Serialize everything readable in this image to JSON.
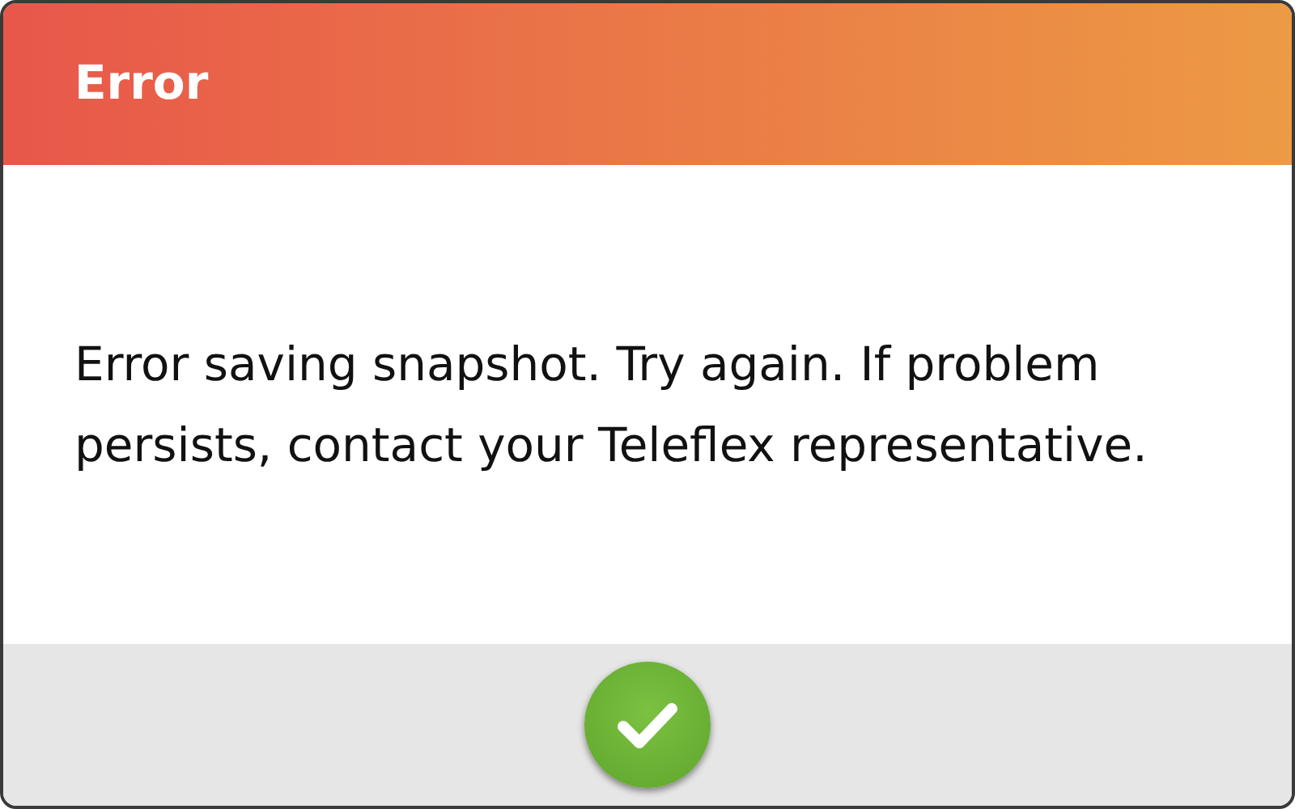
{
  "dialog": {
    "title": "Error",
    "message": "Error saving snapshot. Try again. If problem persists, contact your Teleflex representative.",
    "buttons": [
      {
        "kind": "confirm"
      }
    ]
  }
}
